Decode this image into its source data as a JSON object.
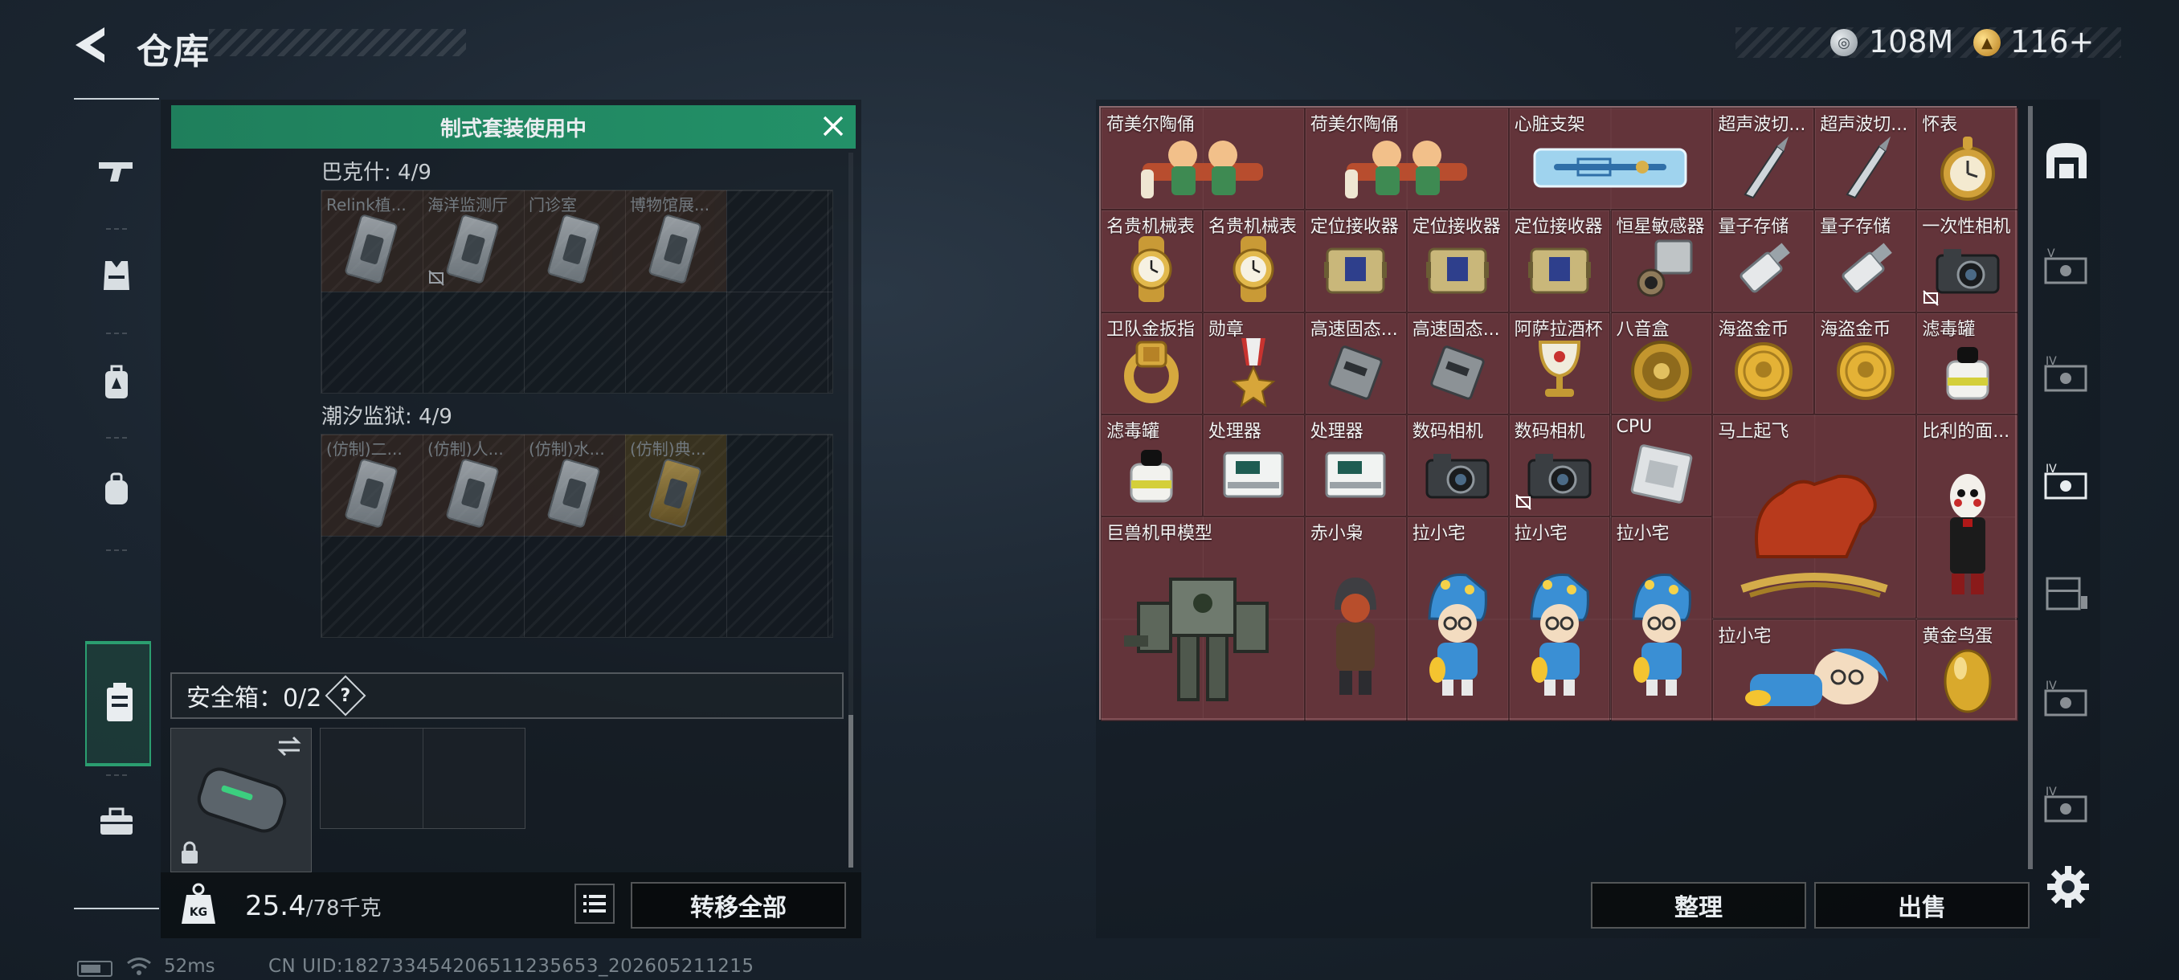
{
  "header": {
    "title": "仓库",
    "coins": "108M",
    "gems": "116+"
  },
  "left_panel": {
    "banner": "制式套装使用中",
    "sections": [
      {
        "title": "巴克什: 4/9",
        "items": [
          {
            "label": "Relink植...",
            "style": "rust"
          },
          {
            "label": "海洋监测厅",
            "style": "rust",
            "no_display": true
          },
          {
            "label": "门诊室",
            "style": "rust"
          },
          {
            "label": "博物馆展...",
            "style": "rust"
          }
        ]
      },
      {
        "title": "潮汐监狱: 4/9",
        "items": [
          {
            "label": "(仿制)二...",
            "style": "rust"
          },
          {
            "label": "(仿制)人...",
            "style": "rust"
          },
          {
            "label": "(仿制)水...",
            "style": "rust"
          },
          {
            "label": "(仿制)典...",
            "style": "gold"
          }
        ]
      }
    ],
    "safebox": {
      "label": "安全箱：0/2",
      "help": "?"
    },
    "weight": {
      "current": "25.4",
      "max": "/78千克"
    },
    "transfer_label": "转移全部"
  },
  "inventory": {
    "items": [
      {
        "label": "荷美尔陶俑",
        "icon": "figurine"
      },
      {
        "label": "荷美尔陶俑",
        "icon": "figurine"
      },
      {
        "label": "心脏支架",
        "icon": "stent"
      },
      {
        "label": "超声波切...",
        "icon": "scalpel"
      },
      {
        "label": "超声波切...",
        "icon": "scalpel"
      },
      {
        "label": "怀表",
        "icon": "pocket-watch"
      },
      {
        "label": "名贵机械表",
        "icon": "wristwatch"
      },
      {
        "label": "名贵机械表",
        "icon": "wristwatch"
      },
      {
        "label": "定位接收器",
        "icon": "receiver"
      },
      {
        "label": "定位接收器",
        "icon": "receiver"
      },
      {
        "label": "定位接收器",
        "icon": "receiver"
      },
      {
        "label": "恒星敏感器",
        "icon": "star-sensor"
      },
      {
        "label": "量子存储",
        "icon": "usb-drive"
      },
      {
        "label": "量子存储",
        "icon": "usb-drive"
      },
      {
        "label": "一次性相机",
        "icon": "camera"
      },
      {
        "label": "卫队金扳指",
        "icon": "gold-ring"
      },
      {
        "label": "勋章",
        "icon": "medal"
      },
      {
        "label": "高速固态...",
        "icon": "ssd"
      },
      {
        "label": "高速固态...",
        "icon": "ssd"
      },
      {
        "label": "阿萨拉酒杯",
        "icon": "goblet"
      },
      {
        "label": "八音盒",
        "icon": "music-box"
      },
      {
        "label": "海盗金币",
        "icon": "gold-coin"
      },
      {
        "label": "海盗金币",
        "icon": "gold-coin"
      },
      {
        "label": "滤毒罐",
        "icon": "filter-canister"
      },
      {
        "label": "滤毒罐",
        "icon": "filter-canister"
      },
      {
        "label": "处理器",
        "icon": "processor"
      },
      {
        "label": "处理器",
        "icon": "processor"
      },
      {
        "label": "数码相机",
        "icon": "camera"
      },
      {
        "label": "数码相机",
        "icon": "camera"
      },
      {
        "label": "CPU",
        "icon": "cpu-chip"
      },
      {
        "label": "马上起飞",
        "icon": "horse-statue"
      },
      {
        "label": "比利的面...",
        "icon": "puppet"
      },
      {
        "label": "巨兽机甲模型",
        "icon": "mech-model"
      },
      {
        "label": "赤小枭",
        "icon": "hooded-figure"
      },
      {
        "label": "拉小宅",
        "icon": "chibi-figure"
      },
      {
        "label": "拉小宅",
        "icon": "chibi-figure"
      },
      {
        "label": "拉小宅",
        "icon": "chibi-figure"
      },
      {
        "label": "拉小宅",
        "icon": "chibi-lying"
      },
      {
        "label": "黄金鸟蛋",
        "icon": "golden-egg"
      }
    ],
    "sort_label": "整理",
    "sell_label": "出售"
  },
  "status": {
    "ping": "52ms",
    "uid": "CN UID:182733454206511235653_202605211215"
  },
  "colors": {
    "accent": "#239168",
    "item_bg": "#78383f",
    "panel": "#12181e"
  }
}
